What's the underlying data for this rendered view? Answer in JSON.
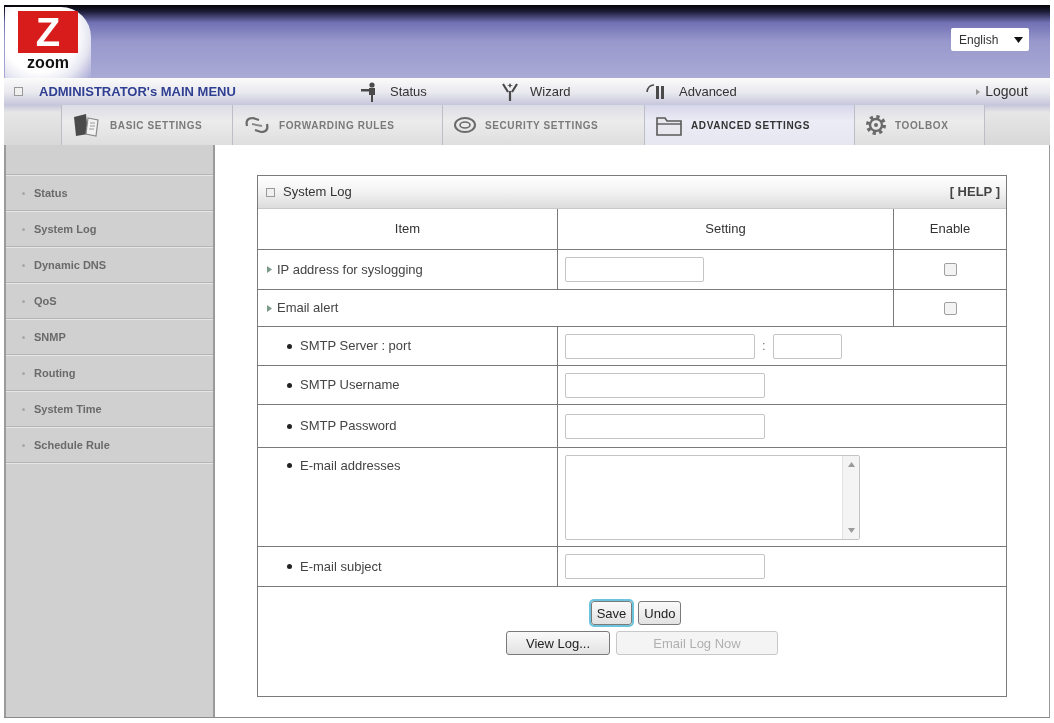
{
  "header": {
    "logo": {
      "mark": "Z",
      "name": "zoom"
    },
    "language": "English"
  },
  "main_menu": {
    "title": "ADMINISTRATOR's MAIN MENU",
    "items": [
      {
        "label": "Status"
      },
      {
        "label": "Wizard"
      },
      {
        "label": "Advanced"
      }
    ],
    "logout": "Logout"
  },
  "tabs": [
    {
      "label": "BASIC SETTINGS",
      "selected": false
    },
    {
      "label": "FORWARDING RULES",
      "selected": false
    },
    {
      "label": "SECURITY SETTINGS",
      "selected": false
    },
    {
      "label": "ADVANCED SETTINGS",
      "selected": true
    },
    {
      "label": "TOOLBOX",
      "selected": false
    }
  ],
  "sidebar": {
    "items": [
      {
        "label": "Status"
      },
      {
        "label": "System Log"
      },
      {
        "label": "Dynamic DNS"
      },
      {
        "label": "QoS"
      },
      {
        "label": "SNMP"
      },
      {
        "label": "Routing"
      },
      {
        "label": "System Time"
      },
      {
        "label": "Schedule Rule"
      }
    ]
  },
  "panel": {
    "title": "System Log",
    "help": "[ HELP ]",
    "columns": [
      "Item",
      "Setting",
      "Enable"
    ],
    "rows": [
      {
        "kind": "option",
        "label": "IP address for syslogging",
        "controls": [
          {
            "kind": "input"
          }
        ],
        "enable": {
          "checked": false
        }
      },
      {
        "kind": "option",
        "label": "Email alert",
        "enable": {
          "checked": false
        }
      },
      {
        "kind": "sub",
        "label": "SMTP Server : port",
        "controls": [
          {
            "kind": "input"
          },
          {
            "kind": "text",
            "text": ":"
          },
          {
            "kind": "input"
          }
        ]
      },
      {
        "kind": "sub",
        "label": "SMTP Username",
        "controls": [
          {
            "kind": "input"
          }
        ]
      },
      {
        "kind": "sub",
        "label": "SMTP Password",
        "controls": [
          {
            "kind": "input"
          }
        ]
      },
      {
        "kind": "sub",
        "label": "E-mail addresses",
        "controls": [
          {
            "kind": "textarea"
          }
        ]
      },
      {
        "kind": "sub",
        "label": "E-mail subject",
        "controls": [
          {
            "kind": "input"
          }
        ]
      }
    ],
    "actions": [
      [
        {
          "label": "Save",
          "focused": true,
          "disabled": false
        },
        {
          "label": "Undo",
          "focused": false,
          "disabled": false
        }
      ],
      [
        {
          "label": "View Log...",
          "focused": false,
          "disabled": false
        },
        {
          "label": "Email Log Now",
          "focused": false,
          "disabled": true
        }
      ]
    ]
  }
}
